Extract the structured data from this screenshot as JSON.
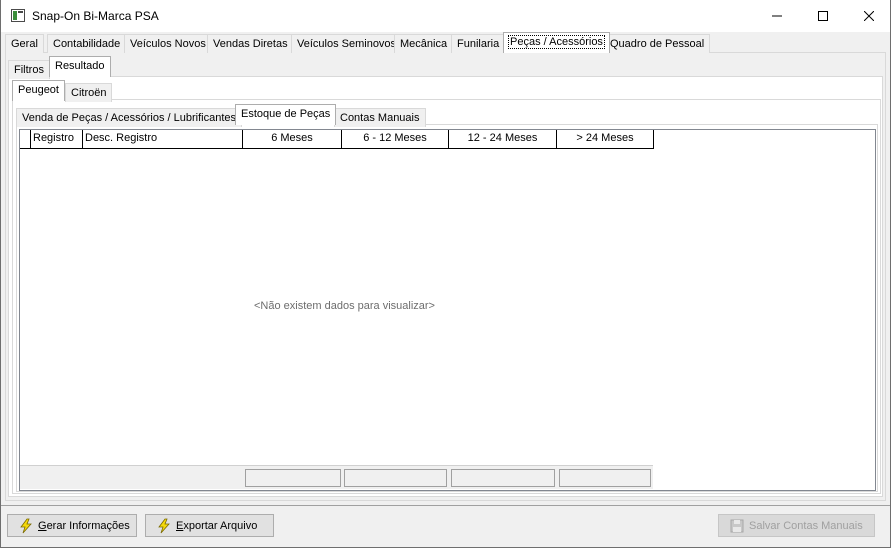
{
  "window": {
    "title": "Snap-On Bi-Marca PSA"
  },
  "main_tabs": [
    "Geral",
    "Contabilidade",
    "Veículos Novos",
    "Vendas Diretas",
    "Veículos Seminovos",
    "Mecânica",
    "Funilaria",
    "Peças / Acessórios",
    "Quadro de Pessoal"
  ],
  "view_tabs": [
    "Filtros",
    "Resultado"
  ],
  "brand_tabs": [
    "Peugeot",
    "Citroën"
  ],
  "sub_tabs": [
    "Venda de Peças / Acessórios / Lubrificantes",
    "Estoque de Peças",
    "Contas Manuais"
  ],
  "grid": {
    "columns": [
      "Registro",
      "Desc. Registro",
      "6 Meses",
      "6 - 12 Meses",
      "12 - 24 Meses",
      "> 24 Meses"
    ],
    "empty_message": "<Não existem dados para visualizar>"
  },
  "buttons": {
    "generate": {
      "label_mnemonic": "G",
      "label_rest": "erar Informações",
      "icon": "lightning-icon"
    },
    "export": {
      "label_mnemonic": "E",
      "label_rest": "xportar Arquivo",
      "icon": "lightning-icon"
    },
    "save": {
      "label": "Salvar Contas Manuais",
      "icon": "floppy-disk-icon"
    }
  },
  "colors": {
    "bolt_fill": "#f5d90a",
    "bolt_stroke": "#7a6a00"
  }
}
